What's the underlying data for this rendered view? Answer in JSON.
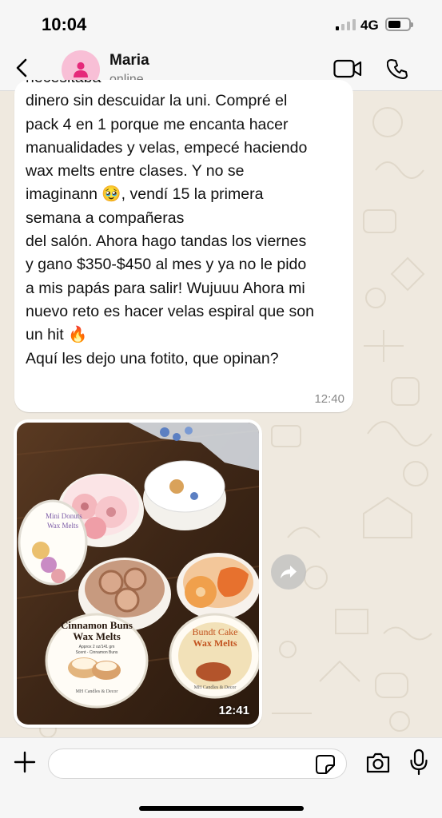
{
  "status_bar": {
    "time": "10:04",
    "network": "4G",
    "signal_icon": "cellular-signal-icon",
    "battery_icon": "battery-icon"
  },
  "header": {
    "contact_name": "Maria",
    "contact_status": "online",
    "back_icon": "chevron-left-icon",
    "avatar_icon": "person-icon",
    "video_icon": "video-call-icon",
    "phone_icon": "phone-icon"
  },
  "messages": [
    {
      "type": "text",
      "lines": [
        "necesitaba",
        "dinero sin descuidar la uni. Compré el",
        "pack 4 en 1 porque me encanta hacer",
        "manualidades y velas, empecé haciendo",
        "wax melts entre clases. Y no se",
        "imaginann 🥹, vendí 15 la primera",
        "semana a compañeras",
        "del salón. Ahora hago tandas los viernes",
        "y gano $350-$450 al mes y ya no le pido",
        "a mis papás para salir! Wujuuu Ahora mi",
        "nuevo reto es hacer velas espiral que son",
        "un hit 🔥",
        "Aquí les dejo una fotito, que opinan?"
      ],
      "time": "12:40"
    },
    {
      "type": "image",
      "time": "12:41",
      "photo_labels": {
        "donut": [
          "Mini Donuts",
          "Wax Melts"
        ],
        "cinnamon": [
          "Cinnamon Buns",
          "Wax Melts",
          "Approx 2 oz/141 gm",
          "Scent - Cinnamon Buns"
        ],
        "bundt": [
          "Bundt Cake",
          "Wax Melts"
        ],
        "brand": "MH Candles & Decor"
      }
    }
  ],
  "input": {
    "placeholder": "",
    "plus_icon": "plus-icon",
    "sticker_icon": "sticker-icon",
    "camera_icon": "camera-icon",
    "mic_icon": "microphone-icon",
    "forward_icon": "forward-arrow-icon"
  },
  "colors": {
    "chat_background": "#efe9df",
    "bubble": "#ffffff",
    "avatar_bg": "#f8bfd6",
    "avatar_fg": "#e5297a",
    "bar_bg": "#f6f6f6"
  }
}
